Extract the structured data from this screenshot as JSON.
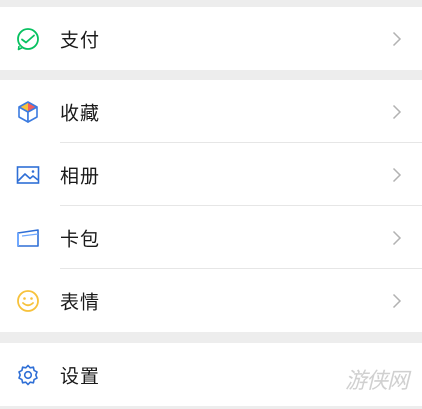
{
  "colors": {
    "background": "#ededed",
    "row_background": "#ffffff",
    "pay_icon": "#07c160",
    "album_icon": "#2f6fd6",
    "cards_icon": "#2f6fd6",
    "emoji_icon": "#f7c23c",
    "settings_icon": "#2f6fd6"
  },
  "menu": {
    "pay": {
      "label": "支付",
      "icon": "pay-check-icon"
    },
    "favorites": {
      "label": "收藏",
      "icon": "favorites-cube-icon"
    },
    "album": {
      "label": "相册",
      "icon": "album-image-icon"
    },
    "cards": {
      "label": "卡包",
      "icon": "card-wallet-icon"
    },
    "stickers": {
      "label": "表情",
      "icon": "smiley-icon"
    },
    "settings": {
      "label": "设置",
      "icon": "gear-icon"
    }
  },
  "watermark": {
    "text": "游侠网"
  }
}
